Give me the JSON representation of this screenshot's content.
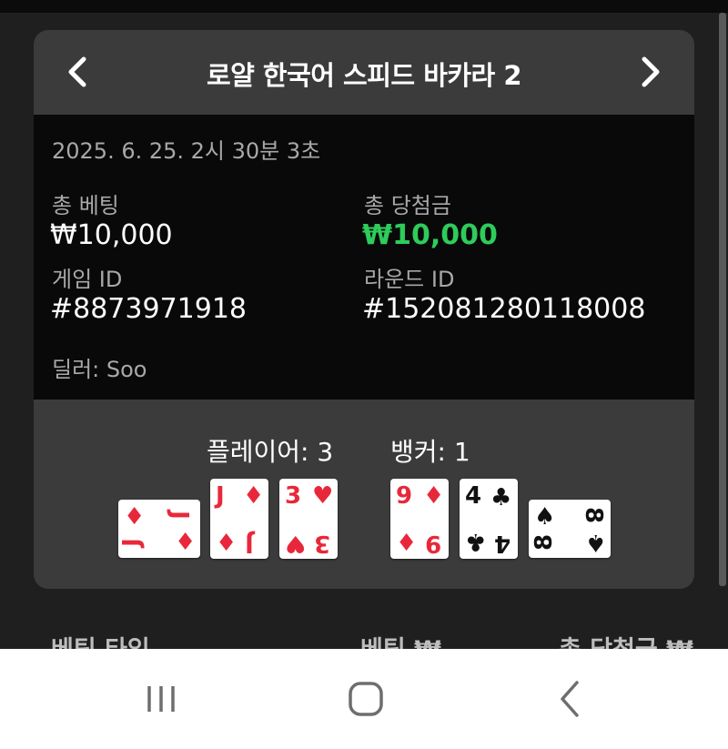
{
  "header": {
    "title": "로얄 한국어 스피드 바카라 2"
  },
  "icons": {
    "prev": "chevron-left-icon",
    "next": "chevron-right-icon"
  },
  "details": {
    "timestamp": "2025. 6. 25. 2시 30분 3초",
    "total_bet_label": "총 베팅",
    "total_bet_value": "₩10,000",
    "total_win_label": "총 당첨금",
    "total_win_value": "₩10,000",
    "game_id_label": "게임 ID",
    "game_id_value": "#8873971918",
    "round_id_label": "라운드 ID",
    "round_id_value": "#152081280118008",
    "dealer": "딜러: Soo"
  },
  "hands": {
    "player_label": "플레이어: 3",
    "banker_label": "뱅커: 1",
    "player_cards": [
      {
        "rank": "J",
        "suit": "diamonds",
        "suit_symbol": "♦",
        "orientation": "sideways"
      },
      {
        "rank": "J",
        "suit": "diamonds",
        "suit_symbol": "♦",
        "orientation": "upright"
      },
      {
        "rank": "3",
        "suit": "hearts",
        "suit_symbol": "♥",
        "orientation": "upright"
      }
    ],
    "banker_cards": [
      {
        "rank": "9",
        "suit": "diamonds",
        "suit_symbol": "♦",
        "orientation": "upright"
      },
      {
        "rank": "4",
        "suit": "clubs",
        "suit_symbol": "♣",
        "orientation": "upright"
      },
      {
        "rank": "8",
        "suit": "spades",
        "suit_symbol": "♠",
        "orientation": "sideways"
      }
    ]
  },
  "table_header": {
    "bet_type": "베팅 타입",
    "bet": "베팅 ₩",
    "total_win": "총 당첨금 ₩"
  },
  "system_nav": {
    "recents": "recents-icon",
    "home": "home-icon",
    "back": "back-icon"
  },
  "colors": {
    "win": "#2ecc5b",
    "red_suit": "#e8283a",
    "card_bg": "#3b3b3b",
    "info_bg": "#090909"
  }
}
